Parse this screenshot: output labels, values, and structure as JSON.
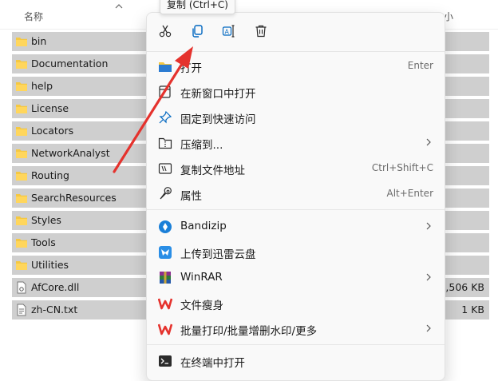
{
  "list": {
    "header_name": "名称",
    "header_size": "小",
    "items": [
      {
        "name": "bin",
        "type": "folder",
        "size": ""
      },
      {
        "name": "Documentation",
        "type": "folder",
        "size": ""
      },
      {
        "name": "help",
        "type": "folder",
        "size": ""
      },
      {
        "name": "License",
        "type": "folder",
        "size": ""
      },
      {
        "name": "Locators",
        "type": "folder",
        "size": ""
      },
      {
        "name": "NetworkAnalyst",
        "type": "folder",
        "size": ""
      },
      {
        "name": "Routing",
        "type": "folder",
        "size": ""
      },
      {
        "name": "SearchResources",
        "type": "folder",
        "size": ""
      },
      {
        "name": "Styles",
        "type": "folder",
        "size": ""
      },
      {
        "name": "Tools",
        "type": "folder",
        "size": ""
      },
      {
        "name": "Utilities",
        "type": "folder",
        "size": ""
      },
      {
        "name": "AfCore.dll",
        "type": "dll",
        "size": "2,506 KB"
      },
      {
        "name": "zh-CN.txt",
        "type": "txt",
        "size": "1 KB"
      }
    ]
  },
  "tooltip": "复制 (Ctrl+C)",
  "quickbar": [
    {
      "icon": "cut-icon"
    },
    {
      "icon": "copy-icon"
    },
    {
      "icon": "rename-icon"
    },
    {
      "icon": "delete-icon"
    }
  ],
  "menu": {
    "items": [
      {
        "label": "打开",
        "shortcut": "Enter",
        "icon": "open-folder-icon",
        "submenu": false
      },
      {
        "label": "在新窗口中打开",
        "shortcut": "",
        "icon": "new-window-icon",
        "submenu": false
      },
      {
        "label": "固定到快速访问",
        "shortcut": "",
        "icon": "pin-icon",
        "submenu": false
      },
      {
        "label": "压缩到...",
        "shortcut": "",
        "icon": "compress-icon",
        "submenu": true
      },
      {
        "label": "复制文件地址",
        "shortcut": "Ctrl+Shift+C",
        "icon": "copy-path-icon",
        "submenu": false
      },
      {
        "label": "属性",
        "shortcut": "Alt+Enter",
        "icon": "properties-icon",
        "submenu": false
      },
      {
        "label": "Bandizip",
        "shortcut": "",
        "icon": "bandizip-icon",
        "submenu": true
      },
      {
        "label": "上传到迅雷云盘",
        "shortcut": "",
        "icon": "xunlei-icon",
        "submenu": false
      },
      {
        "label": "WinRAR",
        "shortcut": "",
        "icon": "winrar-icon",
        "submenu": true
      },
      {
        "label": "文件瘦身",
        "shortcut": "",
        "icon": "wps-icon",
        "submenu": false
      },
      {
        "label": "批量打印/批量增删水印/更多",
        "shortcut": "",
        "icon": "wps-icon",
        "submenu": true
      },
      {
        "label": "在终端中打开",
        "shortcut": "",
        "icon": "terminal-icon",
        "submenu": false
      }
    ]
  },
  "colors": {
    "accent": "#0067c0",
    "selection": "#cfcfcf",
    "menu_bg": "#f9f9f9",
    "arrow": "#e5322d",
    "folder": "#f5c842"
  }
}
